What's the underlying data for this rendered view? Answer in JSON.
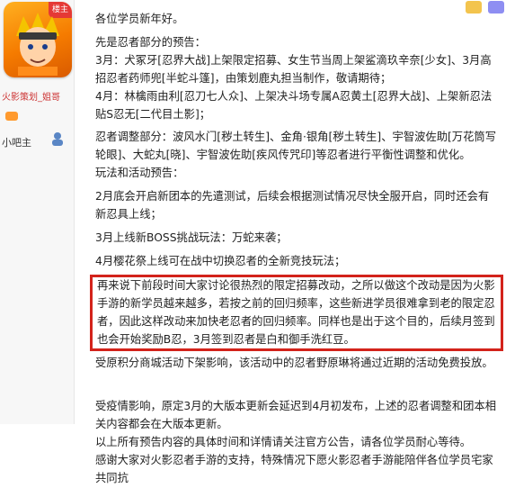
{
  "sidebar": {
    "avatar_tag": "楼主",
    "user_name": "火影策划_姐哥",
    "role": "小吧主"
  },
  "post": {
    "paragraphs": [
      "各位学员新年好。",
      "先是忍者部分的预告：",
      "3月：犬冢牙[忍界大战]上架限定招募、女生节当周上架鲨滴玖辛奈[少女]、3月高招忍者药师兜[半蛇斗篷]，由策划鹿丸担当制作，敬请期待；",
      "4月：林檎雨由利[忍刀七人众]、上架决斗场专属A忍黄土[忍界大战]、上架新忍法贴S忍无[二代目土影]；",
      "忍者调整部分：波风水门[秽土转生]、金角·银角[秽土转生]、宇智波佐助[万花筒写轮眼]、大蛇丸[晓]、宇智波佐助[疾风传咒印]等忍者进行平衡性调整和优化。",
      "玩法和活动预告：",
      "2月底会开启新团本的先遣测试，后续会根据测试情况尽快全服开启，同时还会有新忍具上线；",
      "3月上线新BOSS挑战玩法：万蛇来袭；",
      "4月樱花祭上线可在战中切换忍者的全新竞技玩法；"
    ],
    "highlight": "再来说下前段时间大家讨论很热烈的限定招募改动，之所以做这个改动是因为火影手游的新学员越来越多，若按之前的回归频率，这些新进学员很难拿到老的限定忍者，因此这样改动来加快老忍者的回归频率。同样也是出于这个目的，后续月签到也会开始奖励B忍，3月签到忍者是白和御手洗红豆。",
    "after": "受原积分商城活动下架影响，该活动中的忍者野原琳将通过近期的活动免费投放。",
    "footer": [
      "受疫情影响，原定3月的大版本更新会延迟到4月初发布，上述的忍者调整和团本相关内容都会在大版本更新。",
      "以上所有预告内容的具体时间和详情请关注官方公告，请各位学员耐心等待。",
      "感谢大家对火影忍者手游的支持，特殊情况下愿火影忍者手游能陪伴各位学员宅家共同抗"
    ]
  },
  "colors": {
    "highlight_border": "#d3231b",
    "username": "#cc3333"
  },
  "icons": [
    "user-avatar-icon",
    "badge-icon",
    "moderator-icon",
    "top-tool-icon",
    "top-tool-icon-2"
  ]
}
